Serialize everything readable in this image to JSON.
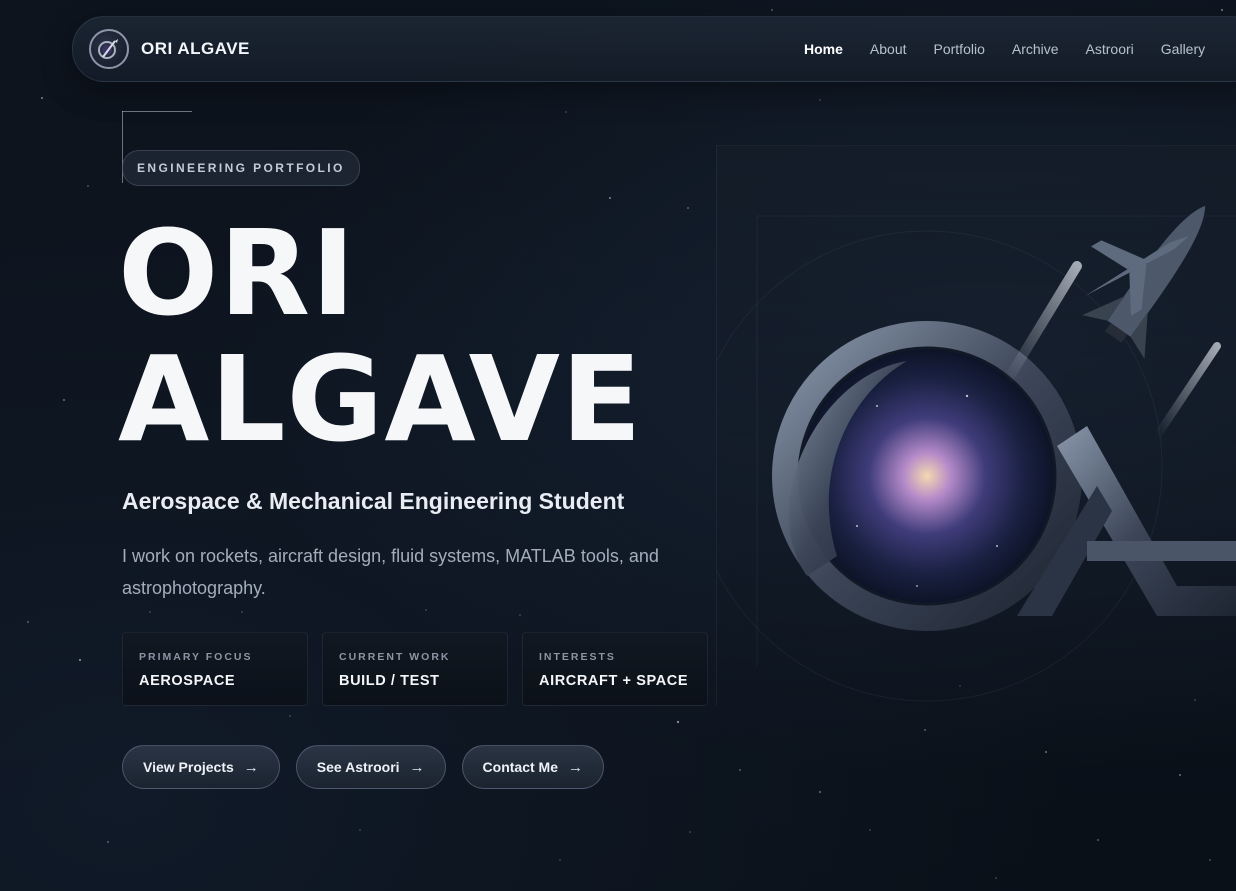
{
  "brand": {
    "name": "ORI ALGAVE"
  },
  "nav": {
    "links": [
      {
        "label": "Home",
        "active": true
      },
      {
        "label": "About",
        "active": false
      },
      {
        "label": "Portfolio",
        "active": false
      },
      {
        "label": "Archive",
        "active": false
      },
      {
        "label": "Astroori",
        "active": false
      },
      {
        "label": "Gallery",
        "active": false
      }
    ]
  },
  "hero": {
    "badge": "ENGINEERING PORTFOLIO",
    "title_line1": "ORI",
    "title_line2": "ALGAVE",
    "subtitle": "Aerospace & Mechanical Engineering Student",
    "description": "I work on rockets, aircraft design, fluid systems, MATLAB tools, and astrophotography."
  },
  "stats": [
    {
      "label": "PRIMARY FOCUS",
      "value": "AEROSPACE"
    },
    {
      "label": "CURRENT WORK",
      "value": "BUILD / TEST"
    },
    {
      "label": "INTERESTS",
      "value": "AIRCRAFT + SPACE"
    }
  ],
  "buttons": [
    {
      "label": "View Projects",
      "icon": "arrow-right-icon"
    },
    {
      "label": "See Astroori",
      "icon": "arrow-right-icon"
    },
    {
      "label": "Contact Me",
      "icon": "arrow-right-icon"
    }
  ],
  "colors": {
    "background": "#0b111a",
    "text_primary": "#f6f7f9",
    "text_muted": "#a4adbb",
    "nav_active": "#ffffff"
  }
}
